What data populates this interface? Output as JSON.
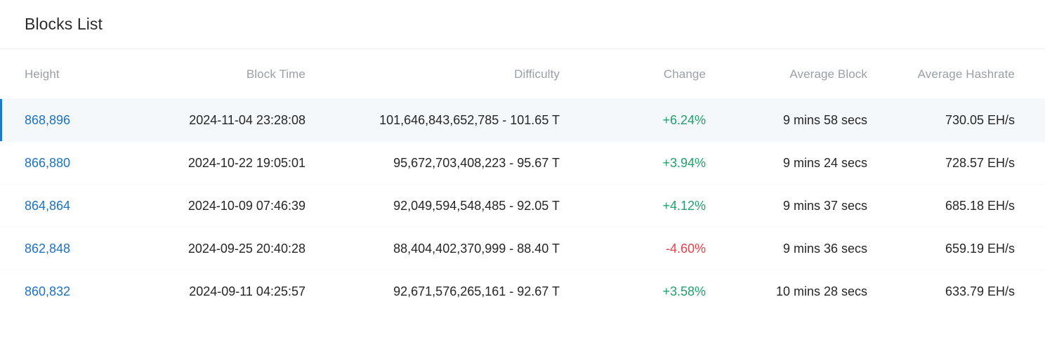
{
  "header": {
    "title": "Blocks List"
  },
  "table": {
    "columns": [
      {
        "key": "height",
        "label": "Height"
      },
      {
        "key": "block_time",
        "label": "Block Time"
      },
      {
        "key": "difficulty",
        "label": "Difficulty"
      },
      {
        "key": "change",
        "label": "Change"
      },
      {
        "key": "average_block",
        "label": "Average Block"
      },
      {
        "key": "average_hashrate",
        "label": "Average Hashrate"
      }
    ],
    "rows": [
      {
        "height": "868,896",
        "block_time": "2024-11-04 23:28:08",
        "difficulty": "101,646,843,652,785 - 101.65 T",
        "change": "+6.24%",
        "change_direction": "positive",
        "average_block": "9 mins 58 secs",
        "average_hashrate": "730.05 EH/s",
        "highlighted": true
      },
      {
        "height": "866,880",
        "block_time": "2024-10-22 19:05:01",
        "difficulty": "95,672,703,408,223 - 95.67 T",
        "change": "+3.94%",
        "change_direction": "positive",
        "average_block": "9 mins 24 secs",
        "average_hashrate": "728.57 EH/s",
        "highlighted": false
      },
      {
        "height": "864,864",
        "block_time": "2024-10-09 07:46:39",
        "difficulty": "92,049,594,548,485 - 92.05 T",
        "change": "+4.12%",
        "change_direction": "positive",
        "average_block": "9 mins 37 secs",
        "average_hashrate": "685.18 EH/s",
        "highlighted": false
      },
      {
        "height": "862,848",
        "block_time": "2024-09-25 20:40:28",
        "difficulty": "88,404,402,370,999 - 88.40 T",
        "change": "-4.60%",
        "change_direction": "negative",
        "average_block": "9 mins 36 secs",
        "average_hashrate": "659.19 EH/s",
        "highlighted": false
      },
      {
        "height": "860,832",
        "block_time": "2024-09-11 04:25:57",
        "difficulty": "92,671,576,265,161 - 92.67 T",
        "change": "+3.58%",
        "change_direction": "positive",
        "average_block": "10 mins 28 secs",
        "average_hashrate": "633.79 EH/s",
        "highlighted": false
      }
    ]
  },
  "colors": {
    "link": "#1d72c2",
    "positive": "#22a06b",
    "negative": "#e8414a",
    "highlight_bg": "#f4f8fb",
    "highlight_accent": "#1f7ac4",
    "header_text": "#9aa0a6"
  }
}
